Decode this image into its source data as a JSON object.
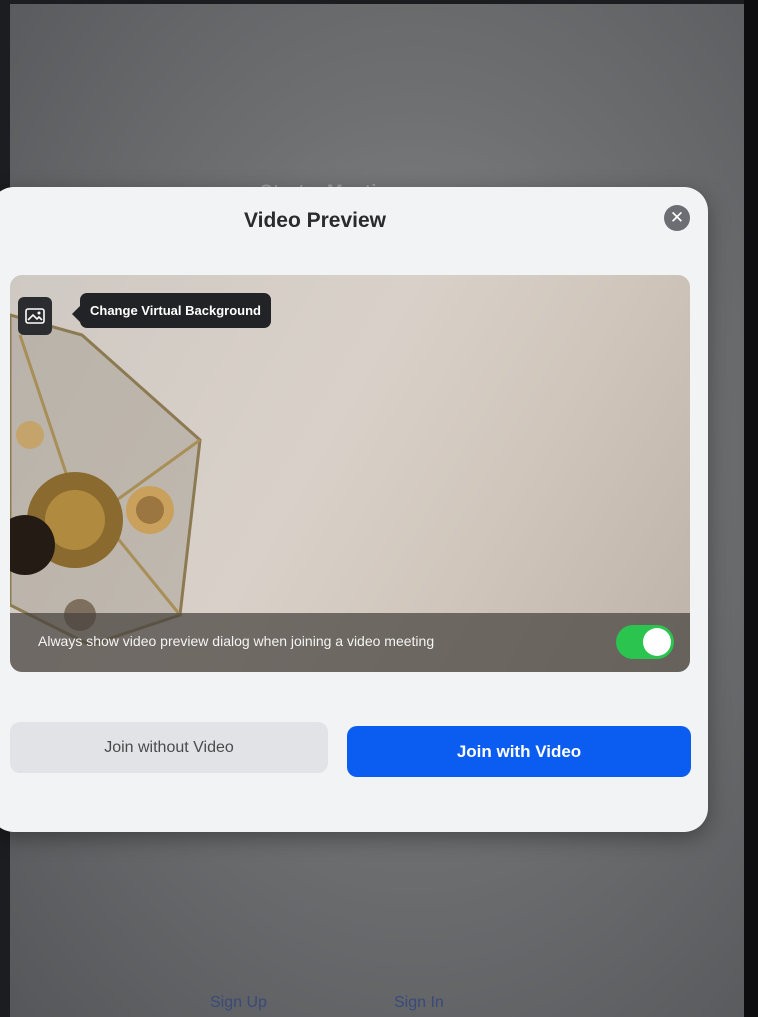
{
  "background": {
    "title": "Start a Meeting",
    "sign_up": "Sign Up",
    "sign_in": "Sign In"
  },
  "dialog": {
    "title": "Video Preview",
    "close_icon": "close-icon",
    "tooltip": "Change Virtual Background",
    "virtual_background_icon": "image-icon",
    "preference_text": "Always show video preview dialog when joining a video meeting",
    "preference_enabled": true,
    "join_without_video": "Join without Video",
    "join_with_video": "Join with Video"
  },
  "colors": {
    "primary_button": "#0b5cf0",
    "toggle_on": "#2bc44e",
    "dialog_bg": "#f2f3f4"
  }
}
